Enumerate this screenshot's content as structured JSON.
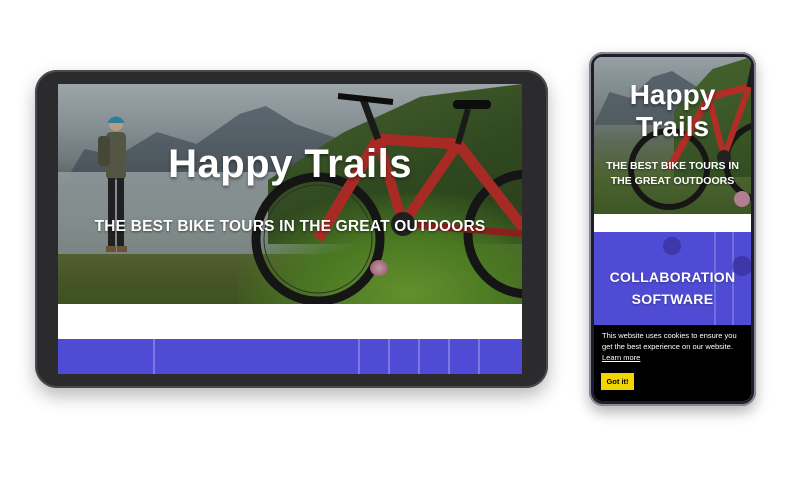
{
  "tablet": {
    "hero": {
      "title": "Happy Trails",
      "subtitle": "THE BEST BIKE TOURS IN THE GREAT OUTDOORS"
    }
  },
  "phone": {
    "hero": {
      "title_line1": "Happy",
      "title_line2": "Trails",
      "subtitle_line1": "THE BEST BIKE TOURS IN",
      "subtitle_line2": "THE GREAT OUTDOORS"
    },
    "feature": {
      "title_line1": "COLLABORATION",
      "title_line2": "SOFTWARE"
    },
    "cookie_banner": {
      "message": "This website uses cookies to ensure you get the best experience on our website.",
      "link_label": "Learn more",
      "button_label": "Got it!"
    }
  },
  "colors": {
    "section_blue": "#4f4bd4",
    "cookie_background": "#000000",
    "cookie_button": "#f1d600",
    "device_frame": "#2b2b2d"
  }
}
